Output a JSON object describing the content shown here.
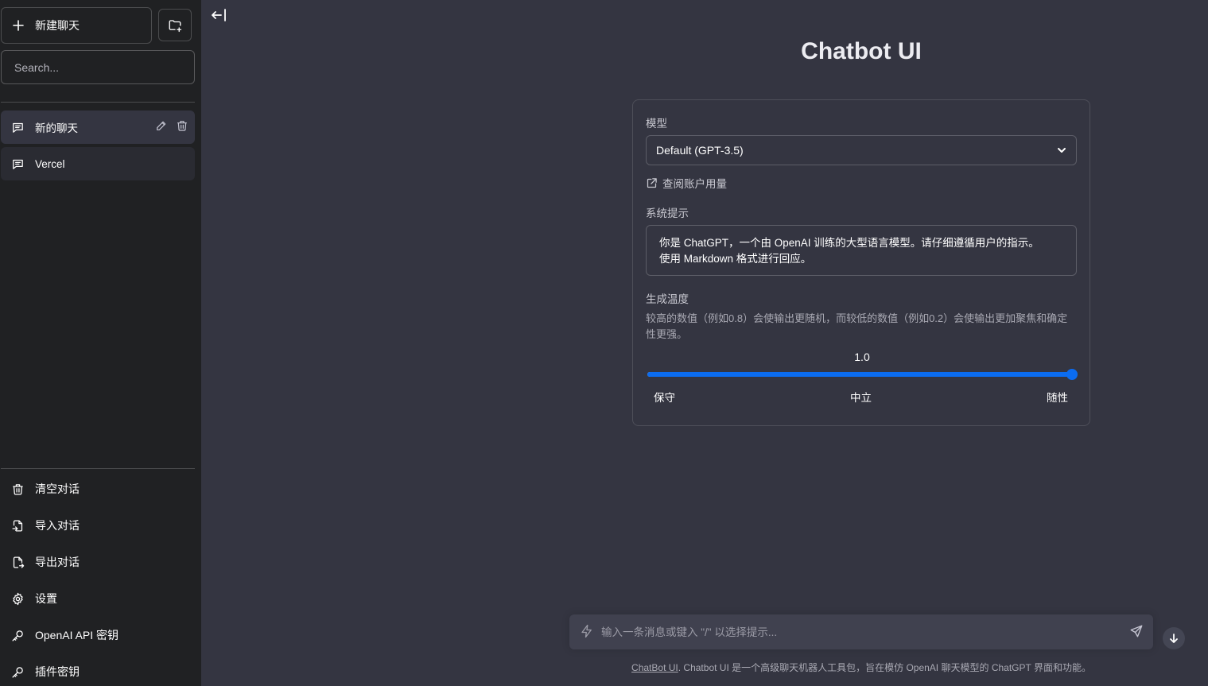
{
  "sidebar": {
    "new_chat_label": "新建聊天",
    "search_placeholder": "Search...",
    "conversations": [
      {
        "label": "新的聊天",
        "active": true
      },
      {
        "label": "Vercel",
        "active": false
      }
    ],
    "bottom_items": [
      {
        "label": "清空对话",
        "icon": "trash-icon"
      },
      {
        "label": "导入对话",
        "icon": "import-file-icon"
      },
      {
        "label": "导出对话",
        "icon": "export-file-icon"
      },
      {
        "label": "设置",
        "icon": "gear-icon"
      },
      {
        "label": "OpenAI API 密钥",
        "icon": "key-icon"
      },
      {
        "label": "插件密钥",
        "icon": "key-icon"
      }
    ]
  },
  "main": {
    "title": "Chatbot UI",
    "model_label": "模型",
    "model_selected": "Default (GPT-3.5)",
    "usage_link": "查阅账户用量",
    "system_prompt_label": "系统提示",
    "system_prompt_line1": "你是 ChatGPT，一个由 OpenAI 训练的大型语言模型。请仔细遵循用户的指示。",
    "system_prompt_line2": "使用 Markdown 格式进行回应。",
    "temperature_label": "生成温度",
    "temperature_desc": "较高的数值（例如0.8）会使输出更随机，而较低的数值（例如0.2）会使输出更加聚焦和确定性更强。",
    "temperature_value": "1.0",
    "temperature_fraction": 1.0,
    "slider_labels": {
      "left": "保守",
      "center": "中立",
      "right": "随性"
    }
  },
  "chat": {
    "input_placeholder": "输入一条消息或键入 \"/\" 以选择提示...",
    "footer_link": "ChatBot UI",
    "footer_text": ". Chatbot UI 是一个高级聊天机器人工具包，旨在模仿 OpenAI 聊天模型的 ChatGPT 界面和功能。"
  },
  "colors": {
    "sidebar_bg": "#202123",
    "main_bg": "#343541",
    "accent": "#0b6cf0"
  }
}
